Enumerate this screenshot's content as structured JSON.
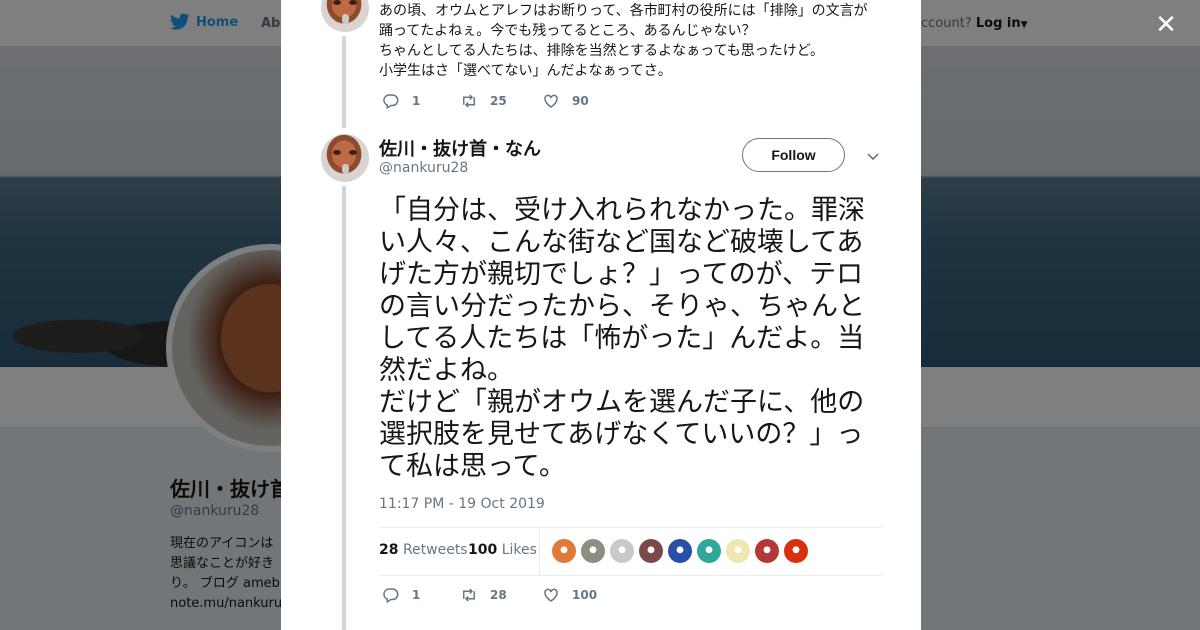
{
  "background": {
    "nav_home": "Home",
    "nav_about": "Abo",
    "account_prompt": "ccount?",
    "login": "Log in",
    "profile_name": "佐川・抜け首",
    "profile_handle": "@nankuru28",
    "bio_lines": [
      "現在のアイコンは",
      "思議なことが好き",
      "り。 ブログ ameb",
      "note.mu/nankuru2"
    ]
  },
  "previous_tweet": {
    "lines": [
      "あの頃、オウムとアレフはお断りって、各市町村の役所には「排除」の文言が",
      "踊ってたよねぇ。今でも残ってるところ、あるんじゃない？",
      "ちゃんとしてる人たちは、排除を当然とするよなぁっても思ったけど。",
      "小学生はさ「選べてない」んだよなぁってさ。"
    ],
    "replies": "1",
    "retweets": "25",
    "likes": "90"
  },
  "tweet": {
    "author_name": "佐川・抜け首・なん",
    "author_handle": "@nankuru28",
    "follow_label": "Follow",
    "text": "「自分は、受け入れられなかった。罪深い人々、こんな街など国など破壊してあげた方が親切でしょ？」ってのが、テロの言い分だったから、そりゃ、ちゃんとしてる人たちは「怖がった」んだよ。当然だよね。\nだけど「親がオウムを選んだ子に、他の選択肢を見せてあげなくていいの？」って私は思って。",
    "timestamp": "11:17 PM - 19 Oct 2019",
    "retweet_count": "28",
    "retweet_label": "Retweets",
    "like_count": "100",
    "like_label": "Likes",
    "replies": "1",
    "retweets": "28",
    "likes": "100"
  },
  "liker_colors": [
    "#e07a3a",
    "#8a8f80",
    "#c9c9c9",
    "#7a4a4a",
    "#2a4fa8",
    "#2fa89a",
    "#efe7b0",
    "#b5373a",
    "#d9310f"
  ],
  "icons": {
    "brand": "twitter-bird-icon",
    "close": "close-icon",
    "reply": "reply-icon",
    "retweet": "retweet-icon",
    "like": "heart-icon",
    "more": "chevron-down-icon"
  }
}
